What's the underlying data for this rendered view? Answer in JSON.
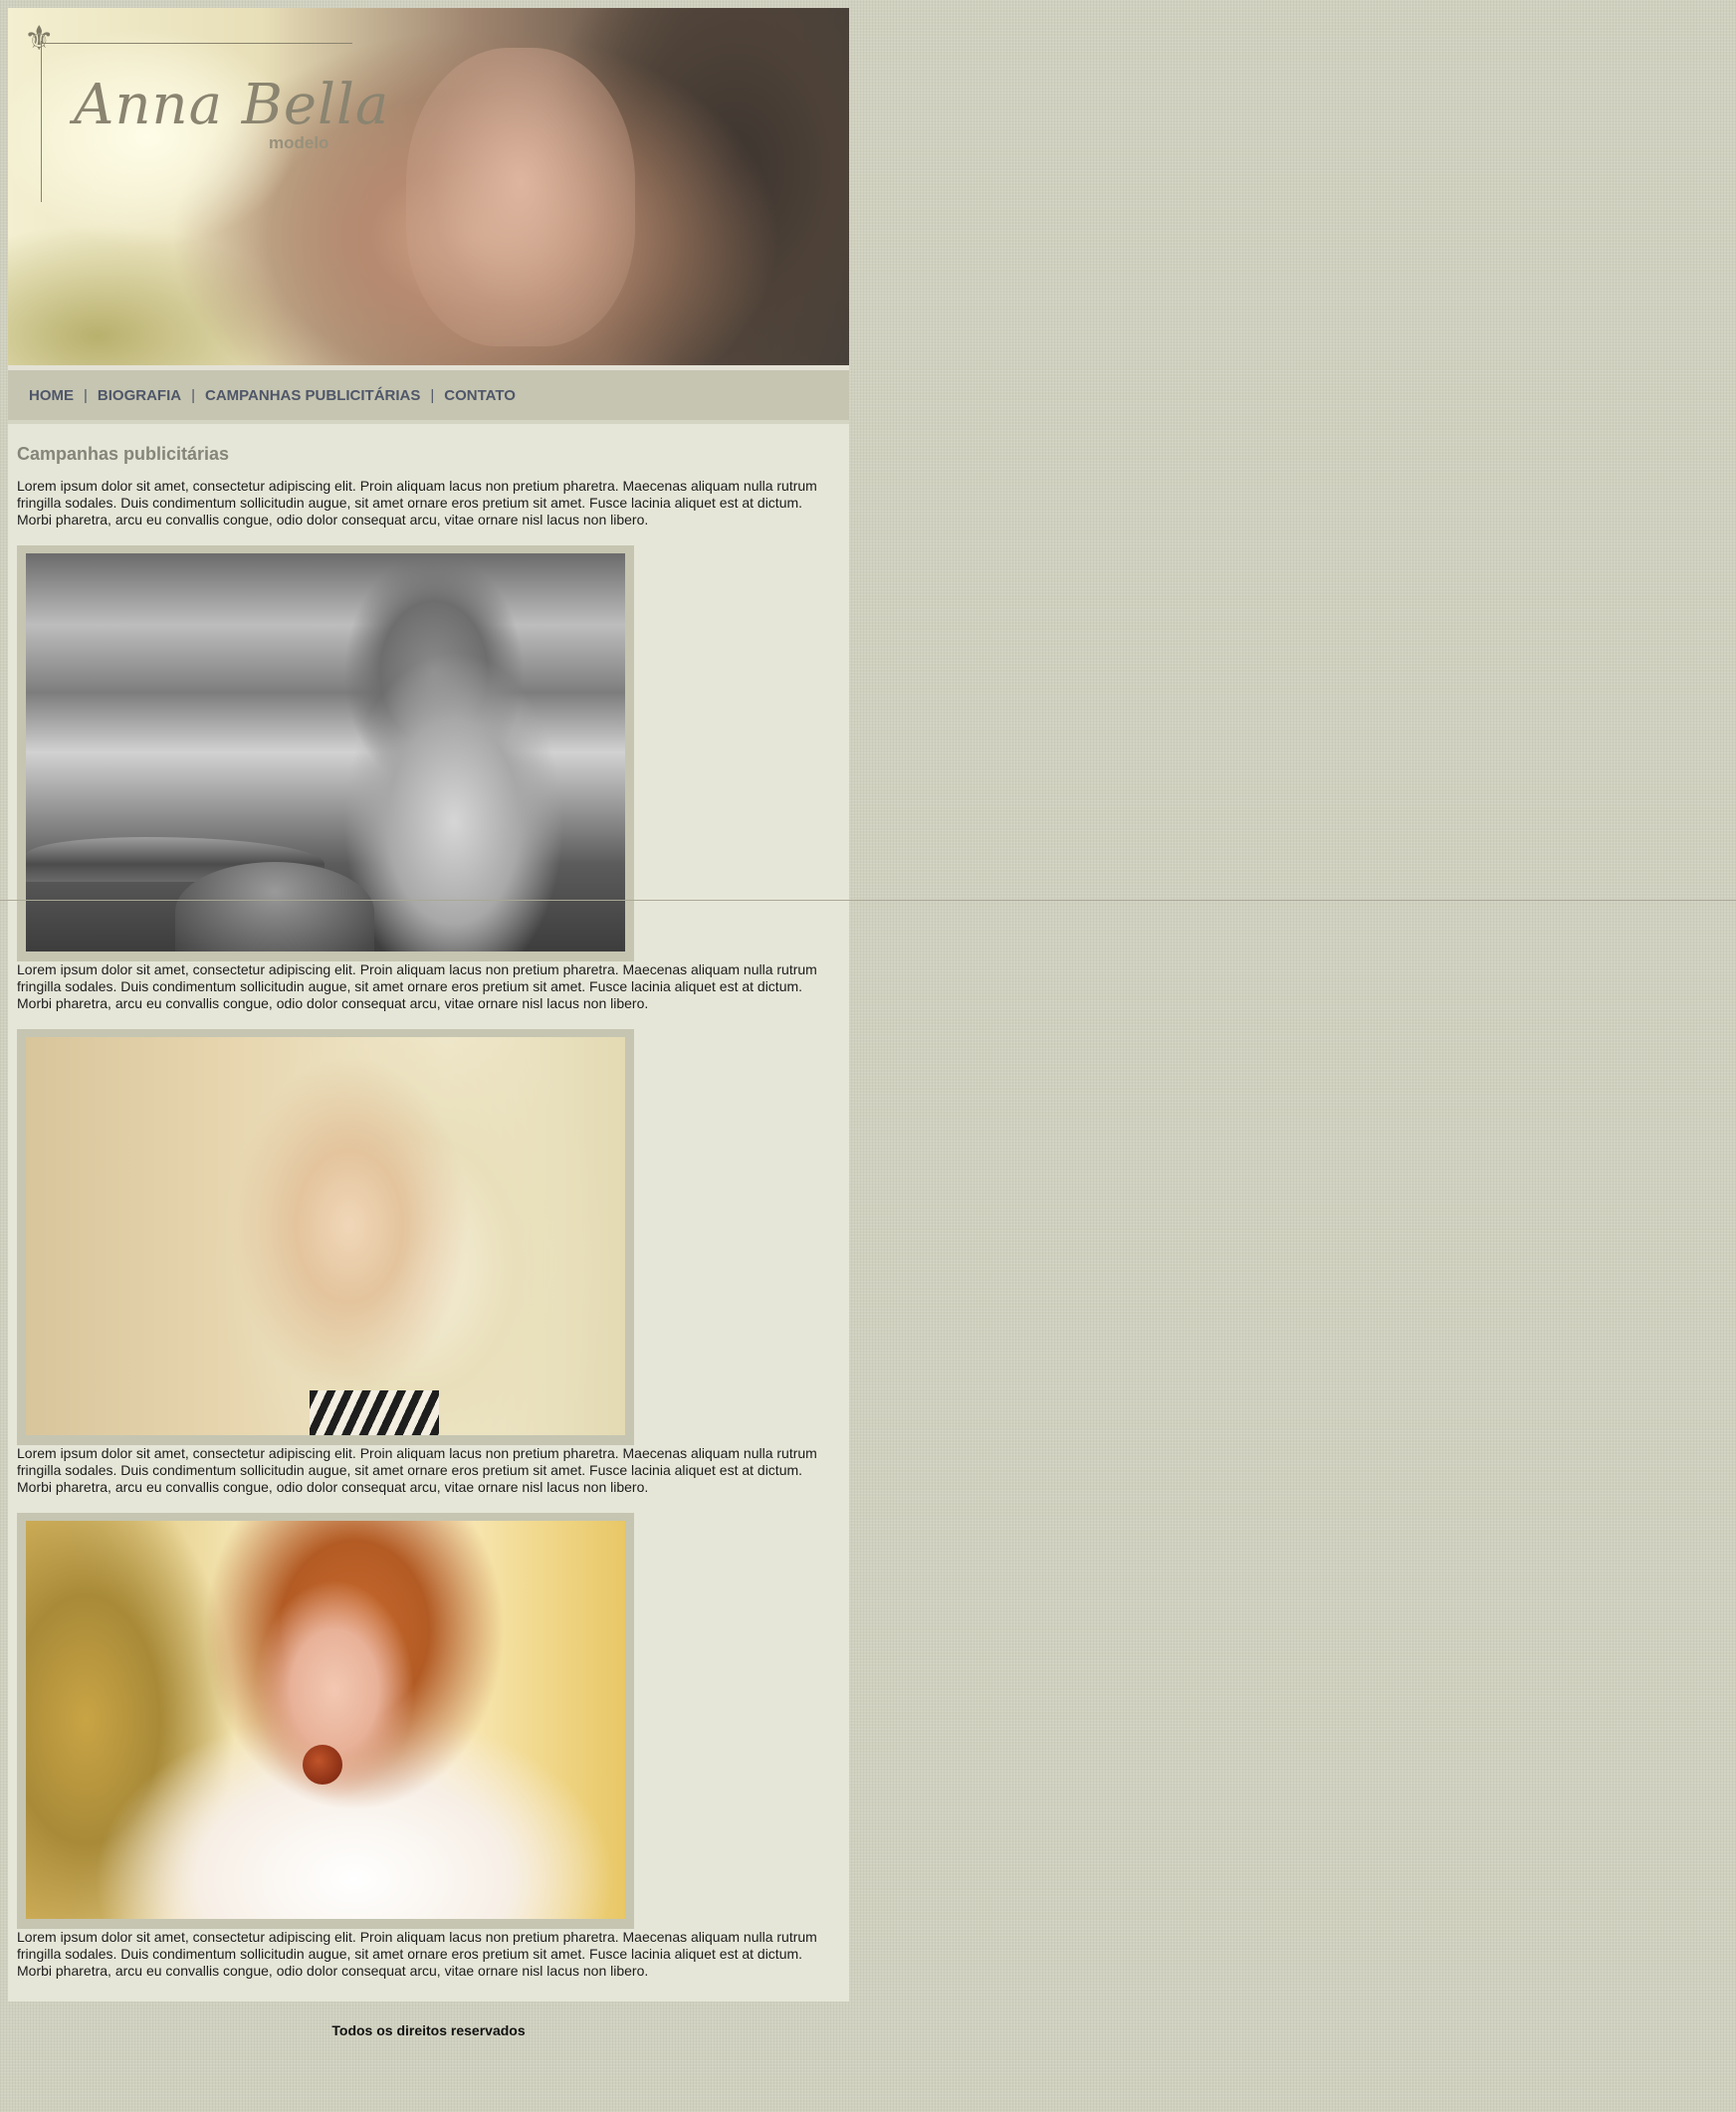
{
  "header": {
    "logo_name": "Anna Bella",
    "logo_sub": "modelo",
    "ornament_icon": "fleur-de-lis-icon"
  },
  "nav": {
    "items": [
      {
        "label": "HOME"
      },
      {
        "label": "BIOGRAFIA"
      },
      {
        "label": "CAMPANHAS PUBLICITÁRIAS"
      },
      {
        "label": "CONTATO"
      }
    ],
    "separator": "|"
  },
  "content": {
    "heading": "Campanhas publicitárias",
    "paragraphs": [
      "Lorem ipsum dolor sit amet, consectetur adipiscing elit. Proin aliquam lacus non pretium pharetra. Maecenas aliquam nulla rutrum fringilla sodales. Duis condimentum sollicitudin augue, sit amet ornare eros pretium sit amet. Fusce lacinia aliquet est at dictum. Morbi pharetra, arcu eu convallis congue, odio dolor consequat arcu, vitae ornare nisl lacus non libero.",
      "Lorem ipsum dolor sit amet, consectetur adipiscing elit. Proin aliquam lacus non pretium pharetra. Maecenas aliquam nulla rutrum fringilla sodales. Duis condimentum sollicitudin augue, sit amet ornare eros pretium sit amet. Fusce lacinia aliquet est at dictum. Morbi pharetra, arcu eu convallis congue, odio dolor consequat arcu, vitae ornare nisl lacus non libero.",
      "Lorem ipsum dolor sit amet, consectetur adipiscing elit. Proin aliquam lacus non pretium pharetra. Maecenas aliquam nulla rutrum fringilla sodales. Duis condimentum sollicitudin augue, sit amet ornare eros pretium sit amet. Fusce lacinia aliquet est at dictum. Morbi pharetra, arcu eu convallis congue, odio dolor consequat arcu, vitae ornare nisl lacus non libero.",
      "Lorem ipsum dolor sit amet, consectetur adipiscing elit. Proin aliquam lacus non pretium pharetra. Maecenas aliquam nulla rutrum fringilla sodales. Duis condimentum sollicitudin augue, sit amet ornare eros pretium sit amet. Fusce lacinia aliquet est at dictum. Morbi pharetra, arcu eu convallis congue, odio dolor consequat arcu, vitae ornare nisl lacus non libero."
    ]
  },
  "footer": {
    "text": "Todos os direitos reservados"
  },
  "colors": {
    "page_background": "#d0d0bf",
    "content_background": "#e6e6d8",
    "nav_background": "#c5c5b1",
    "nav_text": "#4f5669",
    "heading_text": "#85857a",
    "photo_frame": "#c5c5b1"
  }
}
